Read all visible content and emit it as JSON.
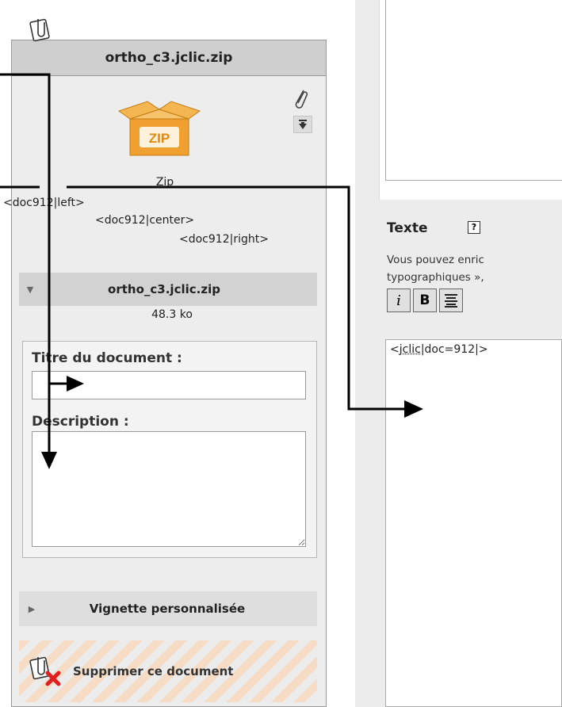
{
  "document": {
    "filename": "ortho_c3.jclic.zip",
    "file_type": "Zip",
    "icon_label": "ZIP",
    "tags": {
      "left": "<doc912|left>",
      "center": "<doc912|center>",
      "right": "<doc912|right>"
    },
    "file_section_title": "ortho_c3.jclic.zip",
    "file_size": "48.3 ko",
    "form": {
      "title_label": "Titre du document :",
      "title_value": "",
      "description_label": "Description :",
      "description_value": ""
    },
    "thumbnail_section": "Vignette personnalisée",
    "delete_label": "Supprimer ce document"
  },
  "text_panel": {
    "heading": "Texte",
    "help_icon": "?",
    "hint_line1": "Vous pouvez enric",
    "hint_line2": "typographiques »,",
    "toolbar": {
      "italic": "i",
      "bold": "B"
    },
    "content_prefix": "<",
    "content_misspelled": "jclic",
    "content_suffix": "|doc=912|>"
  },
  "icons": {
    "attach_tag": "document-attach-icon",
    "archive": "zip-box-icon",
    "paperclip": "paperclip-icon",
    "download": "download-arrow-icon",
    "delete": "delete-document-icon",
    "help": "help-icon"
  },
  "colors": {
    "panel_bg": "#ededed",
    "header_bg": "#cfcfcf",
    "zip_orange": "#f0a030",
    "delete_red": "#e02020",
    "stripe": "#f6dcc4"
  }
}
